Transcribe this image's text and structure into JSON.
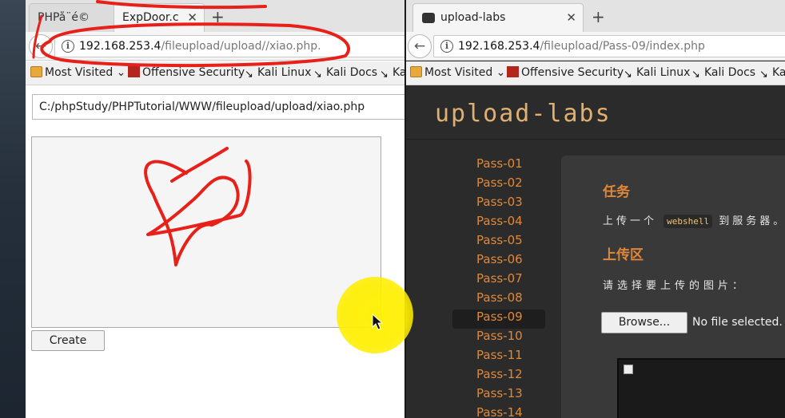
{
  "left": {
    "tabs": [
      {
        "title": "PHPå¨é©"
      },
      {
        "title": "ExpDoor.c"
      }
    ],
    "url_host": "192.168.253.4",
    "url_path": "/fileupload/upload//xiao.php.",
    "bookmarks": [
      "Most Visited",
      "Offensive Security",
      "Kali Linux",
      "Kali Docs",
      "Ka"
    ],
    "path_value": "C:/phpStudy/PHPTutorial/WWW/fileupload/upload/xiao.php",
    "create_label": "Create"
  },
  "right": {
    "tab_title": "upload-labs",
    "url_host": "192.168.253.4",
    "url_path": "/fileupload/Pass-09/index.php",
    "bookmarks": [
      "Most Visited",
      "Offensive Security",
      "Kali Linux",
      "Kali Docs",
      "Ka"
    ],
    "logo_text": "upload-labs",
    "passes": [
      "Pass-01",
      "Pass-02",
      "Pass-03",
      "Pass-04",
      "Pass-05",
      "Pass-06",
      "Pass-07",
      "Pass-08",
      "Pass-09",
      "Pass-10",
      "Pass-11",
      "Pass-12",
      "Pass-13",
      "Pass-14"
    ],
    "active_pass": "Pass-09",
    "task_heading": "任务",
    "task_pre": "上传一个",
    "task_code": "webshell",
    "task_post": "到服务器。",
    "upload_heading": "上传区",
    "choose_text": "请选择要上传的图片：",
    "browse_label": "Browse...",
    "no_file_text": "No file selected."
  },
  "colors": {
    "accent_orange": "#e0883a",
    "annotation_red": "#e8201a",
    "highlight_yellow": "#ffee00"
  }
}
